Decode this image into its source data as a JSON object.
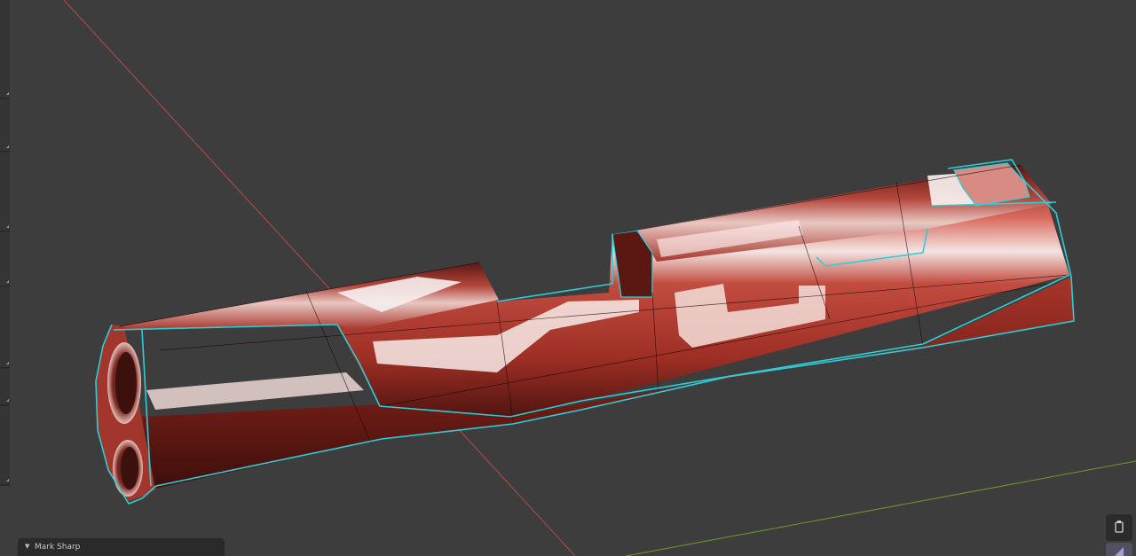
{
  "operator_panel": {
    "label": "Mark Sharp"
  },
  "colors": {
    "background": "#3d3d3d",
    "x_axis": "#b84a4a",
    "y_axis": "#6f9a2c",
    "selection_outline": "#2ccfd8",
    "model": "#b33a30"
  },
  "icons": {
    "collapse": "triangle-down-icon",
    "camera": "camera-icon",
    "perspective": "perspective-toggle-icon"
  }
}
